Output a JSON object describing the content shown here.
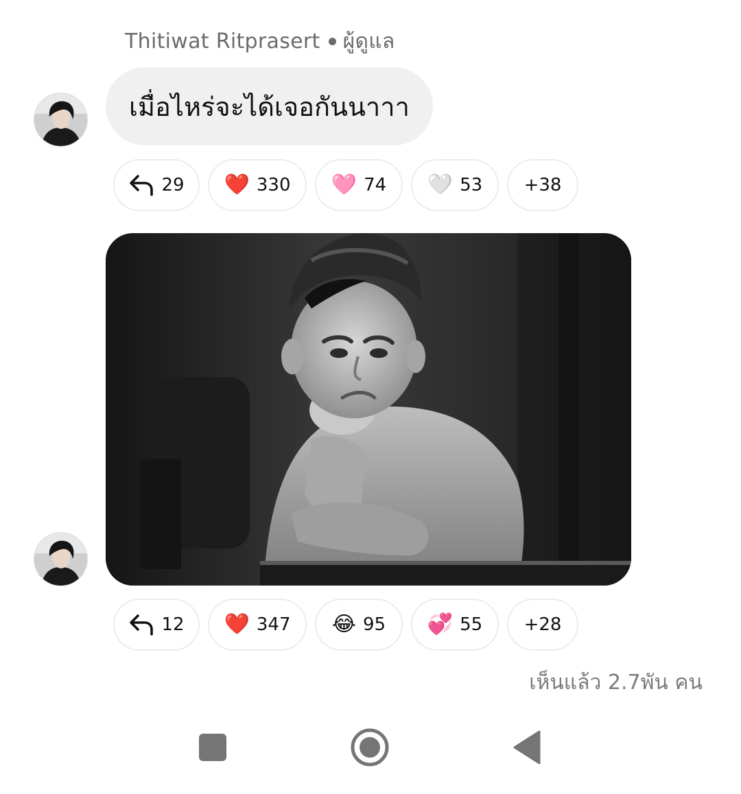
{
  "sender": {
    "name": "Thitiwat  Ritprasert",
    "role": "ผู้ดูแล"
  },
  "messages": [
    {
      "text": "เมื่อไหร่จะได้เจอกันนาาา",
      "reactions": {
        "reply_count": "29",
        "items": [
          {
            "emoji": "❤️",
            "count": "330",
            "icon": "red-heart"
          },
          {
            "emoji": "🩷",
            "count": "74",
            "icon": "pink-heart"
          },
          {
            "emoji": "🤍",
            "count": "53",
            "icon": "white-heart"
          }
        ],
        "more": "+38"
      }
    },
    {
      "media": "grayscale-gif-sad-boy",
      "reactions": {
        "reply_count": "12",
        "items": [
          {
            "emoji": "❤️",
            "count": "347",
            "icon": "red-heart"
          },
          {
            "emoji": "😂",
            "count": "95",
            "icon": "tears-of-joy"
          },
          {
            "emoji": "💞",
            "count": "55",
            "icon": "revolving-hearts"
          }
        ],
        "more": "+28"
      }
    }
  ],
  "seen": "เห็นแล้ว 2.7พัน คน",
  "nav": {
    "recents_icon": "square-icon",
    "home_icon": "circle-icon",
    "back_icon": "triangle-back-icon"
  },
  "colors": {
    "bubble_bg": "#f0f0f0",
    "muted_text": "#6b6b6b",
    "heart_red": "#e0245e",
    "nav_gray": "#757575"
  }
}
